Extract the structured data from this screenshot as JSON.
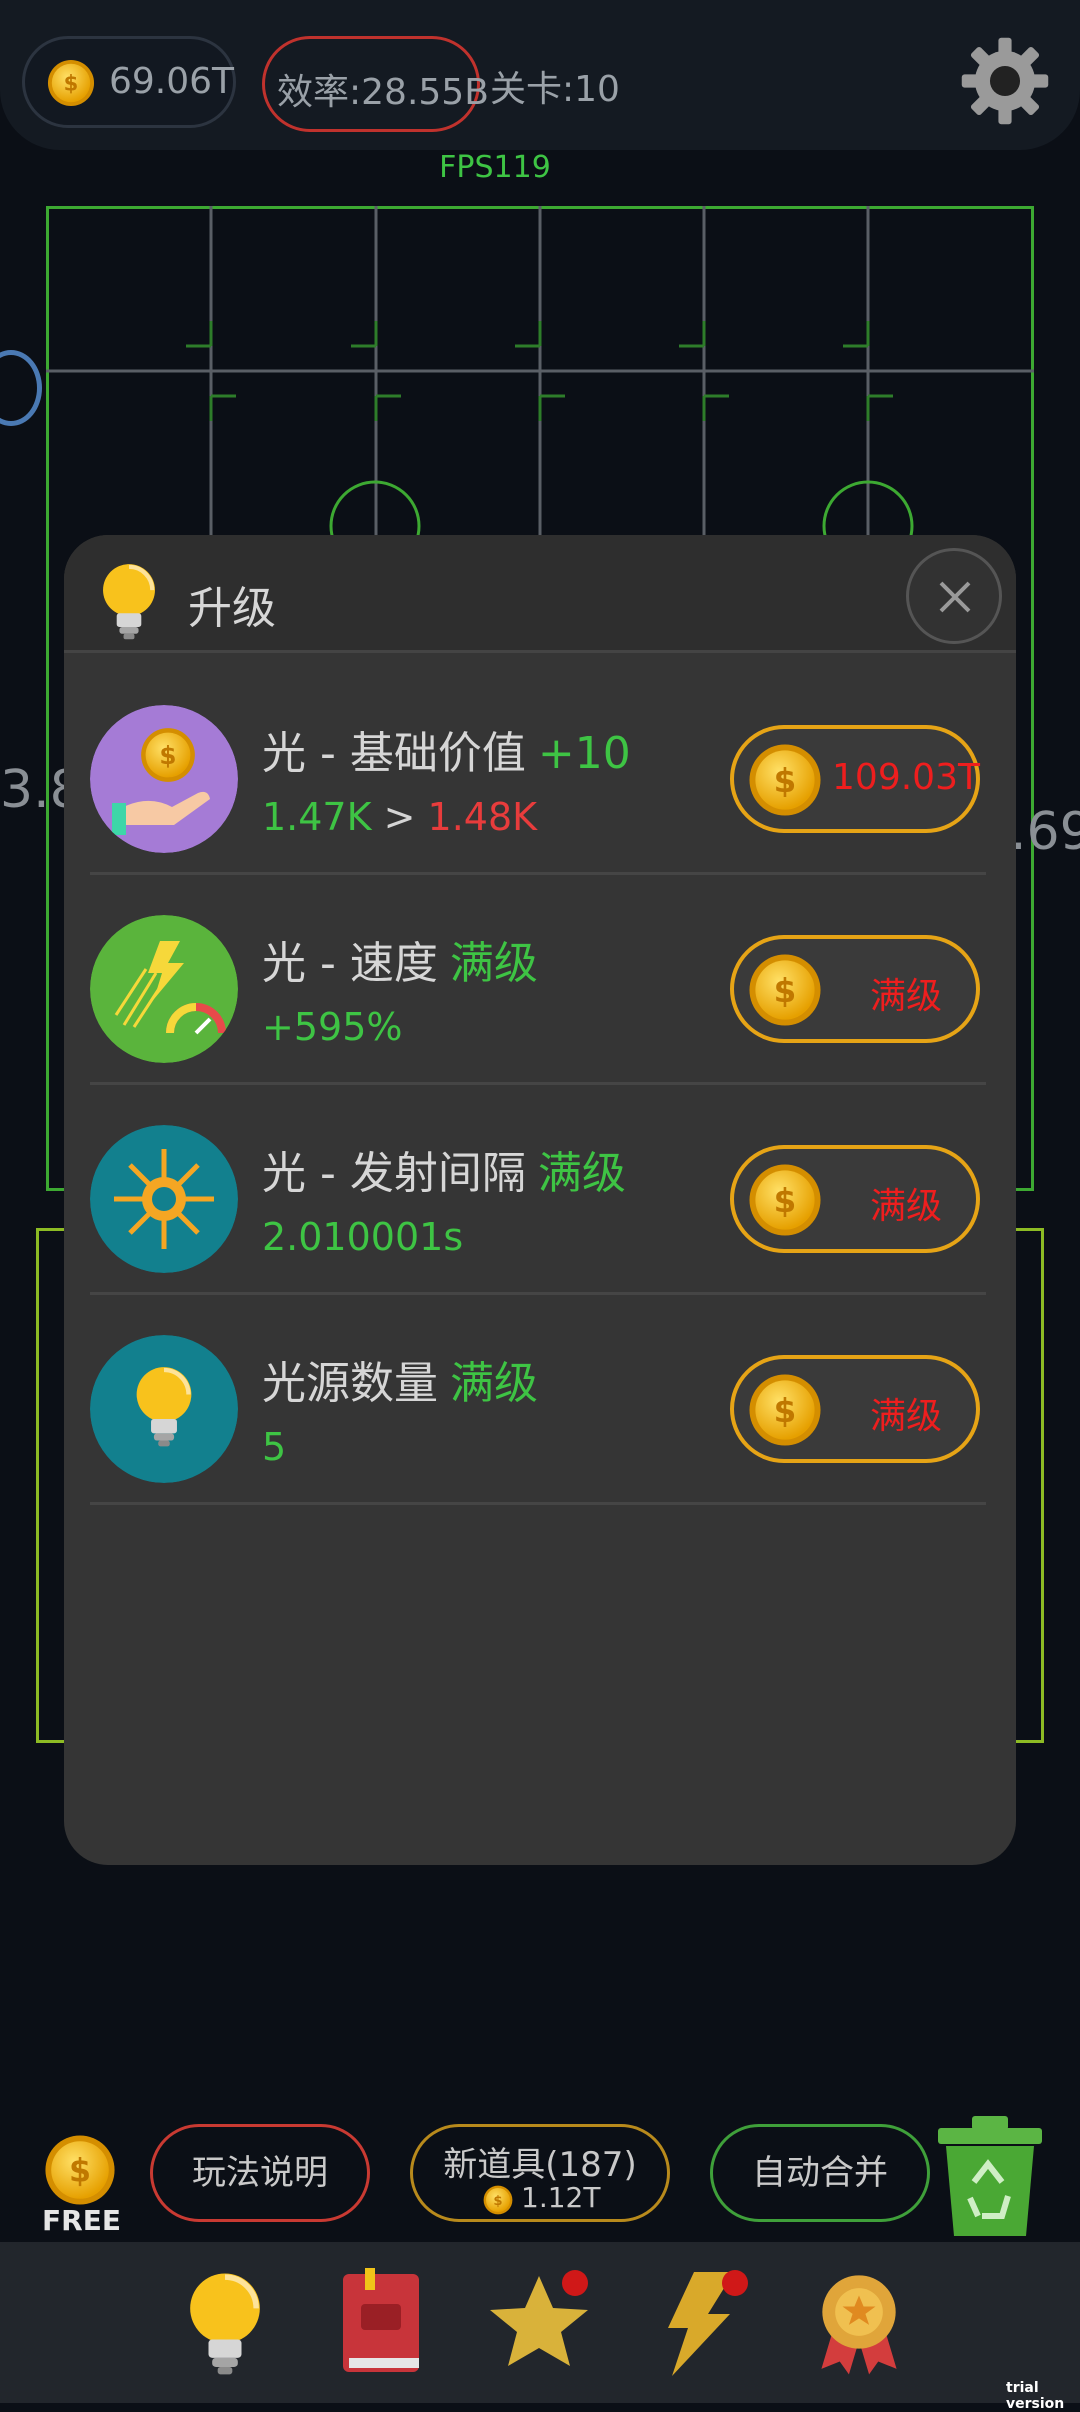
{
  "top": {
    "coins": "69.06T",
    "efficiency": "效率:28.55B",
    "level": "关卡:10",
    "fps": "FPS119"
  },
  "side": {
    "left_value": "3.8",
    "right_value": ".69"
  },
  "modal": {
    "title": "升级",
    "rows": [
      {
        "name": "光 - 基础价值",
        "tag": "+10",
        "sub_from": "1.47K",
        "sub_arrow": " > ",
        "sub_to": "1.48K",
        "price": "109.03T"
      },
      {
        "name": "光 - 速度",
        "tag": "满级",
        "sub": "+595%",
        "price": "满级"
      },
      {
        "name": "光 - 发射间隔",
        "tag": "满级",
        "sub": "2.010001s",
        "price": "满级"
      },
      {
        "name": "光源数量",
        "tag": "满级",
        "sub": "5",
        "price": "满级"
      }
    ]
  },
  "bottom": {
    "free_label": "FREE",
    "rules": "玩法说明",
    "new_items": "新道具(187)",
    "new_items_cost": "1.12T",
    "auto_merge": "自动合并"
  },
  "watermark": "trial version",
  "colors": {
    "green": "#3ec444",
    "red": "#ee1e1e",
    "gold": "#e6a416",
    "panel": "#353535"
  }
}
